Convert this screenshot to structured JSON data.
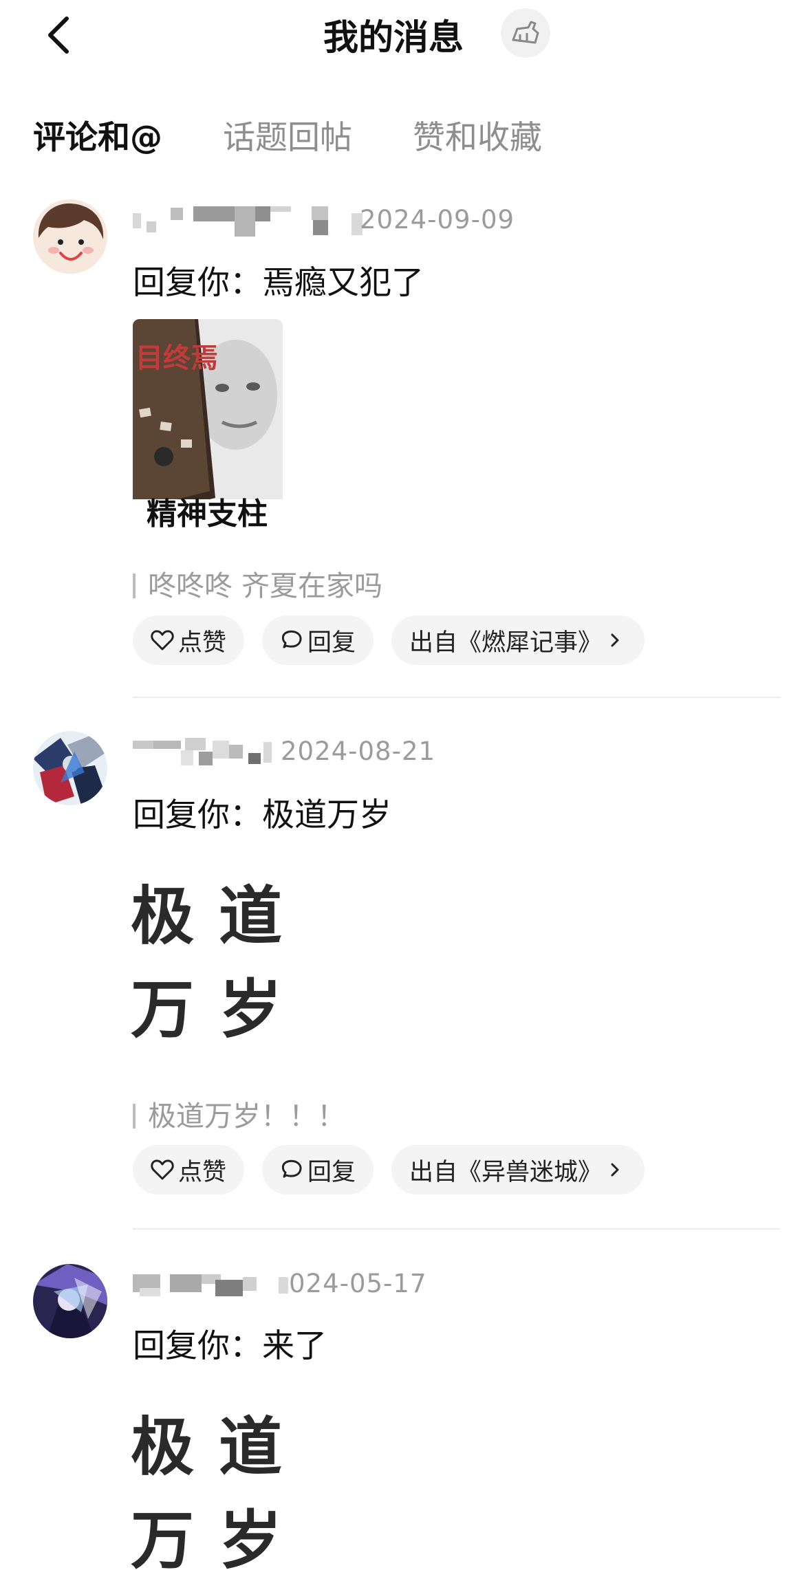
{
  "header": {
    "title": "我的消息",
    "back_icon": "chevron-left-icon",
    "cleanup_icon": "broom-icon"
  },
  "tabs": [
    {
      "label": "评论和@",
      "active": true
    },
    {
      "label": "话题回帖",
      "active": false
    },
    {
      "label": "赞和收藏",
      "active": false
    }
  ],
  "items": [
    {
      "date": "2024-09-09",
      "reply": "回复你：焉瘾又犯了",
      "media": "image",
      "image_text": "精神支柱",
      "quote": "咚咚咚 齐夏在家吗",
      "like_label": "点赞",
      "reply_label": "回复",
      "source_label": "出自《燃犀记事》"
    },
    {
      "date": "2024-08-21",
      "reply": "回复你：极道万岁",
      "media": "text-image",
      "big_text": [
        "极",
        "道",
        "万",
        "岁"
      ],
      "quote": "极道万岁！！！",
      "like_label": "点赞",
      "reply_label": "回复",
      "source_label": "出自《异兽迷城》"
    },
    {
      "date": "024-05-17",
      "reply": "回复你：来了",
      "media": "text-image",
      "big_text": [
        "极",
        "道",
        "万",
        "岁"
      ]
    }
  ],
  "colors": {
    "text_primary": "#111111",
    "text_secondary": "#9b9b9b",
    "pill_bg": "#f4f4f4"
  }
}
